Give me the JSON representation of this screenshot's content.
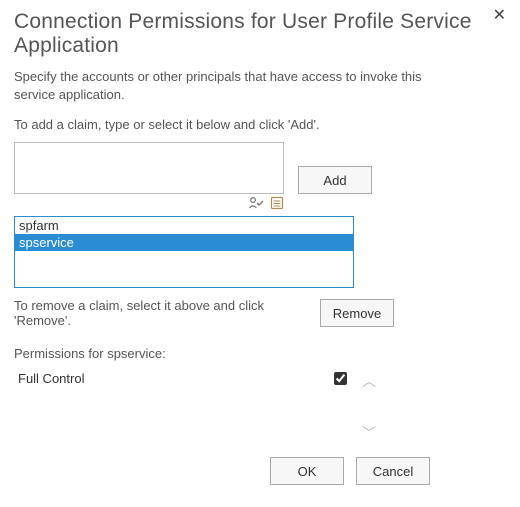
{
  "title": "Connection Permissions for User Profile Service Application",
  "description": "Specify the accounts or other principals that have access to invoke this service application.",
  "add_instruction": "To add a claim, type or select it below and click 'Add'.",
  "claim_input": {
    "value": ""
  },
  "buttons": {
    "add": "Add",
    "remove": "Remove",
    "ok": "OK",
    "cancel": "Cancel"
  },
  "icons": {
    "check_names": "check-names-icon",
    "browse": "browse-icon"
  },
  "claims_list": {
    "items": [
      "spfarm",
      "spservice"
    ],
    "selected_index": 1
  },
  "remove_instruction": "To remove a claim, select it above and click 'Remove'.",
  "permissions": {
    "heading": "Permissions for spservice:",
    "items": [
      {
        "name": "Full Control",
        "checked": true
      }
    ]
  }
}
